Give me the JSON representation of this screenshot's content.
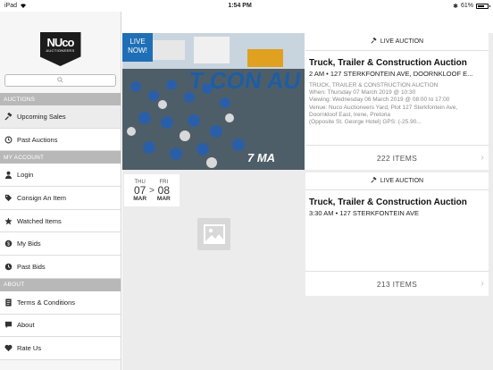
{
  "status_bar": {
    "device": "iPad",
    "time": "1:54 PM",
    "battery": "61%"
  },
  "sidebar": {
    "logo_main": "NUco",
    "logo_sub": "AUCTIONEERS",
    "search_icon": "search-icon",
    "sections": [
      {
        "title": "AUCTIONS",
        "items": [
          {
            "label": "Upcoming Sales",
            "icon": "gavel-icon"
          },
          {
            "label": "Past Auctions",
            "icon": "history-icon"
          }
        ]
      },
      {
        "title": "MY ACCOUNT",
        "items": [
          {
            "label": "Login",
            "icon": "user-icon"
          },
          {
            "label": "Consign An Item",
            "icon": "tag-icon"
          },
          {
            "label": "Watched Items",
            "icon": "star-icon"
          },
          {
            "label": "My Bids",
            "icon": "bid-icon"
          },
          {
            "label": "Past Bids",
            "icon": "past-bid-icon"
          }
        ]
      },
      {
        "title": "ABOUT",
        "items": [
          {
            "label": "Terms & Conditions",
            "icon": "document-icon"
          },
          {
            "label": "About",
            "icon": "info-icon"
          },
          {
            "label": "Rate Us",
            "icon": "heart-icon"
          }
        ]
      }
    ]
  },
  "auctions": [
    {
      "badge": "LIVE AUCTION",
      "live_label_1": "LIVE",
      "live_label_2": "NOW!",
      "photo_text": "T CON AU",
      "photo_text_2": "7 MA",
      "title": "Truck, Trailer & Construction Auction",
      "subtitle": "2 AM • 127 STERKFONTEIN AVE, DOORNKLOOF E...",
      "desc": [
        "TRUCK, TRAILER & CONSTRUCTION AUCTION",
        "When: Thursday 07 March 2019 @ 10:30",
        "Viewing: Wednesday 06 March 2019 @ 08:00 to 17:00",
        "Venue: Nuco Auctioneers Yard, Plot 127 Sterkfontein Ave,",
        "Doornkloof East, Irene, Pretoria",
        "(Opposite St. George Hotel) GPS: (-25.90..."
      ],
      "items_count": "222 ITEMS"
    },
    {
      "badge": "LIVE AUCTION",
      "title": "Truck, Trailer & Construction Auction",
      "subtitle": "3:30 AM • 127 STERKFONTEIN AVE",
      "items_count": "213 ITEMS",
      "date_start": {
        "dow": "THU",
        "num": "07",
        "mon": "MAR"
      },
      "date_sep": ">",
      "date_end": {
        "dow": "FRI",
        "num": "08",
        "mon": "MAR"
      }
    }
  ],
  "colors": {
    "accent": "#1f6fb6",
    "section_bg": "#b8b8b8"
  }
}
